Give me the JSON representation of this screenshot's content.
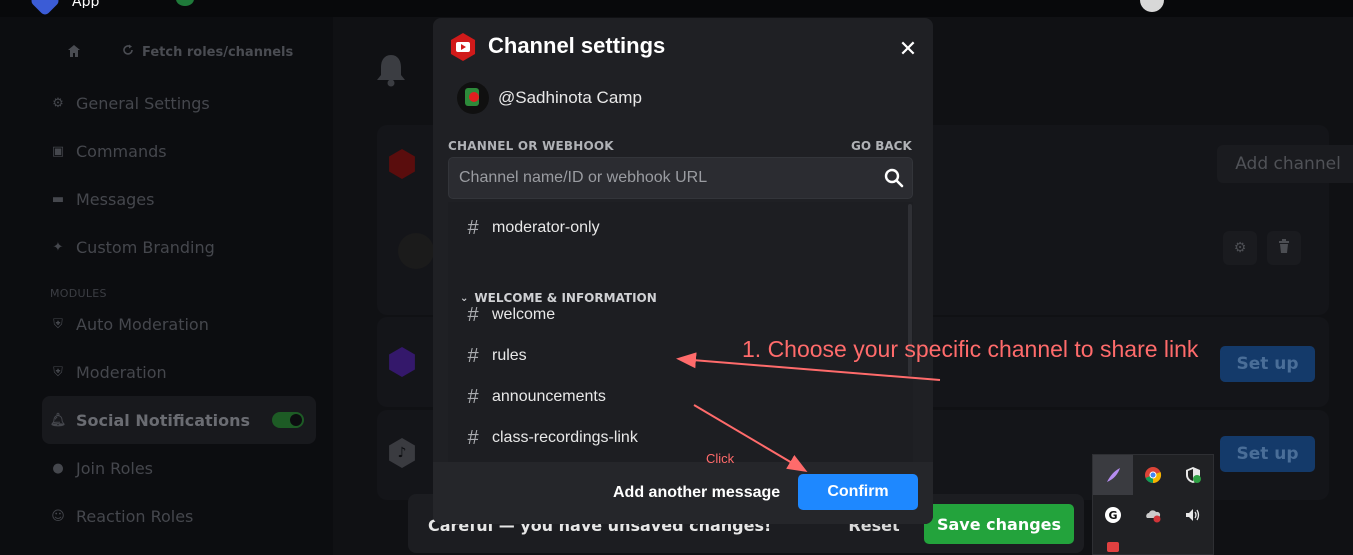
{
  "topbar": {
    "app_name": "App"
  },
  "sidebar": {
    "top_actions": {
      "fetch_label": "Fetch roles/channels"
    },
    "items": [
      {
        "label": "General Settings",
        "icon": "gear-icon"
      },
      {
        "label": "Commands",
        "icon": "commands-icon"
      },
      {
        "label": "Messages",
        "icon": "chat-icon"
      },
      {
        "label": "Custom Branding",
        "icon": "branding-icon"
      }
    ],
    "modules_label": "MODULES",
    "module_items": [
      {
        "label": "Auto Moderation",
        "icon": "shield-icon"
      },
      {
        "label": "Moderation",
        "icon": "shield-icon"
      },
      {
        "label": "Social Notifications",
        "icon": "bell-icon",
        "active": true
      },
      {
        "label": "Join Roles",
        "icon": "user-icon"
      },
      {
        "label": "Reaction Roles",
        "icon": "smile-icon"
      }
    ]
  },
  "main": {
    "add_channel_label": "Add channel",
    "setup_labels": [
      "Set up",
      "Set up"
    ]
  },
  "unsaved_bar": {
    "text": "Careful — you have unsaved changes!",
    "reset_label": "Reset",
    "save_label": "Save changes"
  },
  "modal": {
    "title": "Channel settings",
    "account_name": "@Sadhinota Camp",
    "section_label": "CHANNEL OR WEBHOOK",
    "go_back_label": "GO BACK",
    "search_placeholder": "Channel name/ID or webhook URL",
    "channels_top": [
      "moderator-only"
    ],
    "category": "WELCOME & INFORMATION",
    "channels": [
      "welcome",
      "rules",
      "announcements",
      "class-recordings-link"
    ],
    "add_message_label": "Add another message",
    "confirm_label": "Confirm"
  },
  "annotations": {
    "instruction": "1. Choose your specific channel to share link",
    "click_hint": "Click",
    "color": "#ff6b6b"
  },
  "colors": {
    "accent_blue": "#1e88ff",
    "save_green": "#23a33c",
    "youtube_red": "#d11a1a"
  }
}
